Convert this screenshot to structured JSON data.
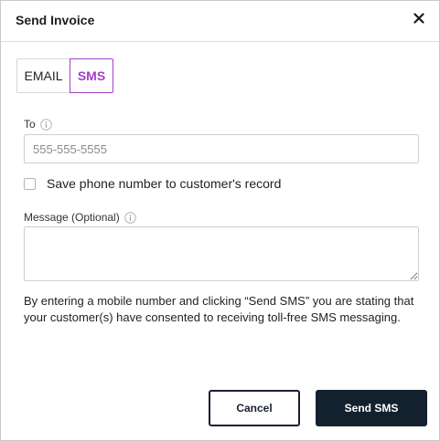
{
  "dialog": {
    "title": "Send Invoice"
  },
  "tabs": [
    {
      "label": "EMAIL",
      "active": false
    },
    {
      "label": "SMS",
      "active": true
    }
  ],
  "to_field": {
    "label": "To",
    "placeholder": "555-555-5555",
    "value": ""
  },
  "save_checkbox": {
    "label": "Save phone number to customer's record",
    "checked": false
  },
  "message_field": {
    "label": "Message (Optional)",
    "value": ""
  },
  "disclaimer": "By entering a mobile number and clicking “Send SMS” you are stating that your customer(s) have consented to receiving toll-free SMS messaging.",
  "buttons": {
    "cancel_label": "Cancel",
    "send_label": "Send SMS"
  },
  "icons": {
    "close": "close-icon",
    "info": "info-icon"
  },
  "colors": {
    "accent": "#a43fc9",
    "primary_button": "#13202e"
  }
}
